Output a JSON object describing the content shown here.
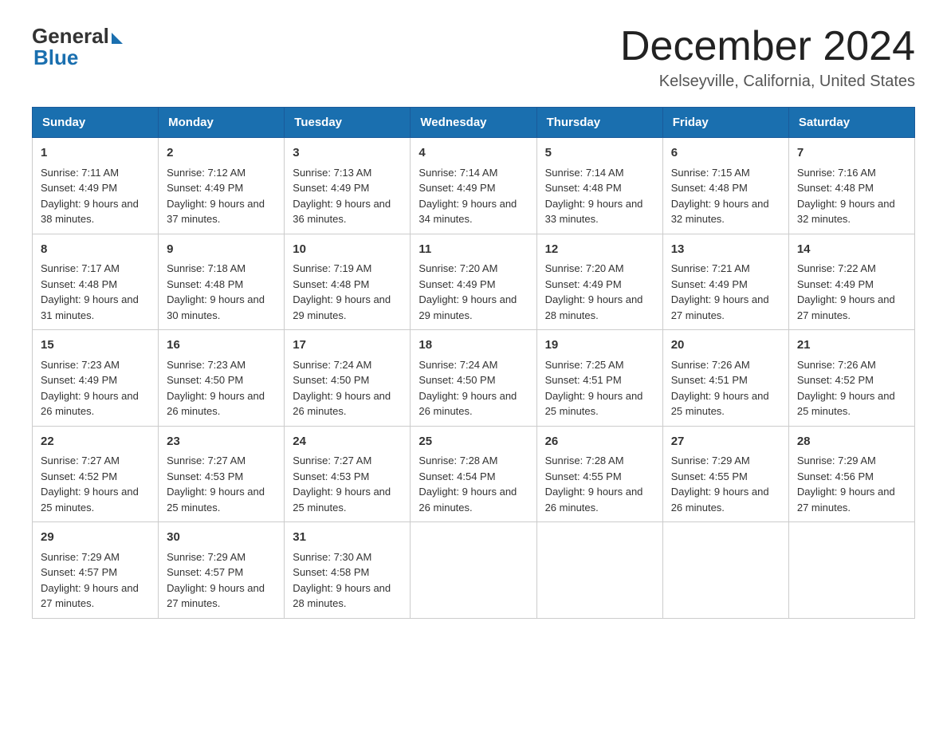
{
  "logo": {
    "general": "General",
    "blue": "Blue"
  },
  "title": "December 2024",
  "location": "Kelseyville, California, United States",
  "weekdays": [
    "Sunday",
    "Monday",
    "Tuesday",
    "Wednesday",
    "Thursday",
    "Friday",
    "Saturday"
  ],
  "weeks": [
    [
      {
        "day": "1",
        "sunrise": "7:11 AM",
        "sunset": "4:49 PM",
        "daylight": "9 hours and 38 minutes."
      },
      {
        "day": "2",
        "sunrise": "7:12 AM",
        "sunset": "4:49 PM",
        "daylight": "9 hours and 37 minutes."
      },
      {
        "day": "3",
        "sunrise": "7:13 AM",
        "sunset": "4:49 PM",
        "daylight": "9 hours and 36 minutes."
      },
      {
        "day": "4",
        "sunrise": "7:14 AM",
        "sunset": "4:49 PM",
        "daylight": "9 hours and 34 minutes."
      },
      {
        "day": "5",
        "sunrise": "7:14 AM",
        "sunset": "4:48 PM",
        "daylight": "9 hours and 33 minutes."
      },
      {
        "day": "6",
        "sunrise": "7:15 AM",
        "sunset": "4:48 PM",
        "daylight": "9 hours and 32 minutes."
      },
      {
        "day": "7",
        "sunrise": "7:16 AM",
        "sunset": "4:48 PM",
        "daylight": "9 hours and 32 minutes."
      }
    ],
    [
      {
        "day": "8",
        "sunrise": "7:17 AM",
        "sunset": "4:48 PM",
        "daylight": "9 hours and 31 minutes."
      },
      {
        "day": "9",
        "sunrise": "7:18 AM",
        "sunset": "4:48 PM",
        "daylight": "9 hours and 30 minutes."
      },
      {
        "day": "10",
        "sunrise": "7:19 AM",
        "sunset": "4:48 PM",
        "daylight": "9 hours and 29 minutes."
      },
      {
        "day": "11",
        "sunrise": "7:20 AM",
        "sunset": "4:49 PM",
        "daylight": "9 hours and 29 minutes."
      },
      {
        "day": "12",
        "sunrise": "7:20 AM",
        "sunset": "4:49 PM",
        "daylight": "9 hours and 28 minutes."
      },
      {
        "day": "13",
        "sunrise": "7:21 AM",
        "sunset": "4:49 PM",
        "daylight": "9 hours and 27 minutes."
      },
      {
        "day": "14",
        "sunrise": "7:22 AM",
        "sunset": "4:49 PM",
        "daylight": "9 hours and 27 minutes."
      }
    ],
    [
      {
        "day": "15",
        "sunrise": "7:23 AM",
        "sunset": "4:49 PM",
        "daylight": "9 hours and 26 minutes."
      },
      {
        "day": "16",
        "sunrise": "7:23 AM",
        "sunset": "4:50 PM",
        "daylight": "9 hours and 26 minutes."
      },
      {
        "day": "17",
        "sunrise": "7:24 AM",
        "sunset": "4:50 PM",
        "daylight": "9 hours and 26 minutes."
      },
      {
        "day": "18",
        "sunrise": "7:24 AM",
        "sunset": "4:50 PM",
        "daylight": "9 hours and 26 minutes."
      },
      {
        "day": "19",
        "sunrise": "7:25 AM",
        "sunset": "4:51 PM",
        "daylight": "9 hours and 25 minutes."
      },
      {
        "day": "20",
        "sunrise": "7:26 AM",
        "sunset": "4:51 PM",
        "daylight": "9 hours and 25 minutes."
      },
      {
        "day": "21",
        "sunrise": "7:26 AM",
        "sunset": "4:52 PM",
        "daylight": "9 hours and 25 minutes."
      }
    ],
    [
      {
        "day": "22",
        "sunrise": "7:27 AM",
        "sunset": "4:52 PM",
        "daylight": "9 hours and 25 minutes."
      },
      {
        "day": "23",
        "sunrise": "7:27 AM",
        "sunset": "4:53 PM",
        "daylight": "9 hours and 25 minutes."
      },
      {
        "day": "24",
        "sunrise": "7:27 AM",
        "sunset": "4:53 PM",
        "daylight": "9 hours and 25 minutes."
      },
      {
        "day": "25",
        "sunrise": "7:28 AM",
        "sunset": "4:54 PM",
        "daylight": "9 hours and 26 minutes."
      },
      {
        "day": "26",
        "sunrise": "7:28 AM",
        "sunset": "4:55 PM",
        "daylight": "9 hours and 26 minutes."
      },
      {
        "day": "27",
        "sunrise": "7:29 AM",
        "sunset": "4:55 PM",
        "daylight": "9 hours and 26 minutes."
      },
      {
        "day": "28",
        "sunrise": "7:29 AM",
        "sunset": "4:56 PM",
        "daylight": "9 hours and 27 minutes."
      }
    ],
    [
      {
        "day": "29",
        "sunrise": "7:29 AM",
        "sunset": "4:57 PM",
        "daylight": "9 hours and 27 minutes."
      },
      {
        "day": "30",
        "sunrise": "7:29 AM",
        "sunset": "4:57 PM",
        "daylight": "9 hours and 27 minutes."
      },
      {
        "day": "31",
        "sunrise": "7:30 AM",
        "sunset": "4:58 PM",
        "daylight": "9 hours and 28 minutes."
      },
      null,
      null,
      null,
      null
    ]
  ],
  "labels": {
    "sunrise": "Sunrise:",
    "sunset": "Sunset:",
    "daylight": "Daylight:"
  }
}
